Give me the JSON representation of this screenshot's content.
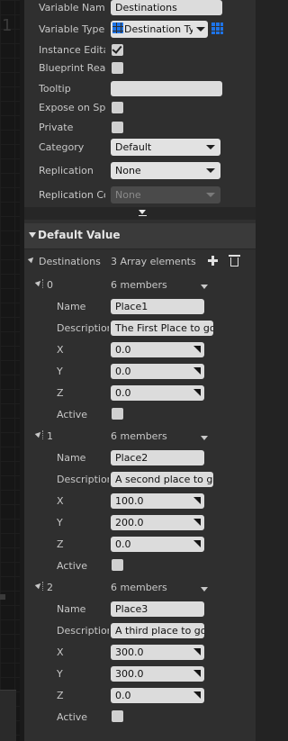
{
  "variable": {
    "name_label": "Variable Name",
    "name_value": "Destinations",
    "type_label": "Variable Type",
    "type_value": "Destination Typ",
    "instance_editable_label": "Instance Editat",
    "instance_editable_checked": true,
    "blueprint_readonly_label": "Blueprint Read",
    "blueprint_readonly_checked": false,
    "tooltip_label": "Tooltip",
    "tooltip_value": "",
    "expose_spawn_label": "Expose on Spat",
    "expose_spawn_checked": false,
    "private_label": "Private",
    "private_checked": false,
    "category_label": "Category",
    "category_value": "Default",
    "replication_label": "Replication",
    "replication_value": "None",
    "replication_condition_label": "Replication Cor",
    "replication_condition_value": "None"
  },
  "default_value": {
    "section_title": "Default Value",
    "array_label": "Destinations",
    "array_summary": "3 Array elements",
    "elements": [
      {
        "index": "0",
        "members_text": "6 members",
        "name_label": "Name",
        "name_value": "Place1",
        "description_label": "Description",
        "description_value": "The First Place to go",
        "x_label": "X",
        "x_value": "0.0",
        "y_label": "Y",
        "y_value": "0.0",
        "z_label": "Z",
        "z_value": "0.0",
        "active_label": "Active",
        "active_checked": false
      },
      {
        "index": "1",
        "members_text": "6 members",
        "name_label": "Name",
        "name_value": "Place2",
        "description_label": "Description",
        "description_value": "A second place to go",
        "x_label": "X",
        "x_value": "100.0",
        "y_label": "Y",
        "y_value": "200.0",
        "z_label": "Z",
        "z_value": "0.0",
        "active_label": "Active",
        "active_checked": false
      },
      {
        "index": "2",
        "members_text": "6 members",
        "name_label": "Name",
        "name_value": "Place3",
        "description_label": "Description",
        "description_value": "A third place to go",
        "x_label": "X",
        "x_value": "300.0",
        "y_label": "Y",
        "y_value": "300.0",
        "z_label": "Z",
        "z_value": "0.0",
        "active_label": "Active",
        "active_checked": false
      }
    ]
  },
  "graph": {
    "partial_number": "1"
  },
  "colors": {
    "panel_bg": "#2f2f2f",
    "accent_blue": "#1e74e8",
    "field_bg": "#dcdcdc"
  },
  "icons": {
    "add": "plus-icon",
    "delete": "trash-icon",
    "type_grid": "array-grid-icon",
    "expand": "chevron-down-icon"
  }
}
